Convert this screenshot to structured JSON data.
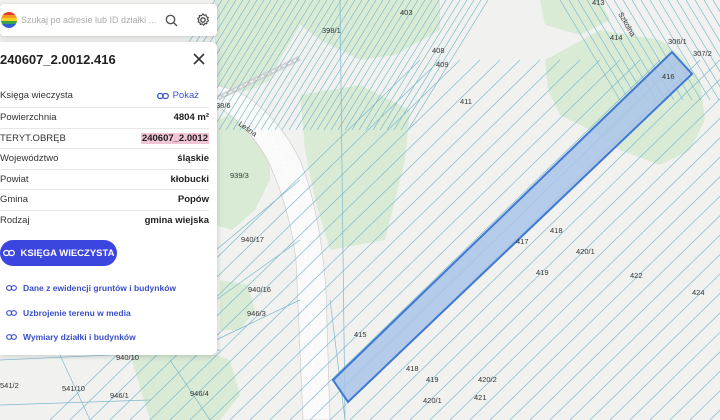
{
  "search": {
    "placeholder": "Szukaj po adresie lub ID działki ..."
  },
  "panel": {
    "title": "240607_2.0012.416",
    "rows": [
      {
        "label": "Księga wieczysta",
        "value": "Pokaż"
      },
      {
        "label": "Powierzchnia",
        "value": "4804 m²"
      },
      {
        "label": "TERYT.OBRĘB",
        "value": "240607_2.0012"
      },
      {
        "label": "Województwo",
        "value": "śląskie"
      },
      {
        "label": "Powiat",
        "value": "kłobucki"
      },
      {
        "label": "Gmina",
        "value": "Popów"
      },
      {
        "label": "Rodzaj",
        "value": "gmina wiejska"
      }
    ],
    "button_label": "KSIĘGA WIECZYSTA",
    "links": [
      "Dane z ewidencji gruntów i budynków",
      "Uzbrojenie terenu w media",
      "Wymiary działki i budynków"
    ]
  },
  "map": {
    "parcel_labels": [
      "413",
      "403",
      "398/1",
      "408",
      "409",
      "411",
      "414",
      "306/1",
      "307/2",
      "416",
      "38/6",
      "939/3",
      "940/17",
      "940/16",
      "946/3",
      "940/10",
      "541/2",
      "541/10",
      "946/1",
      "946/4",
      "415",
      "417",
      "418",
      "419",
      "420/1",
      "420/2",
      "421",
      "422",
      "424",
      "418",
      "419",
      "420/1"
    ],
    "street_label": "Leśna",
    "street_label_top": "Szkolna",
    "colors": {
      "highlight_fill": "#a9c4e8",
      "highlight_stroke": "#3f78d4",
      "green": "#d7ead3",
      "line": "#7bb8c9"
    }
  }
}
